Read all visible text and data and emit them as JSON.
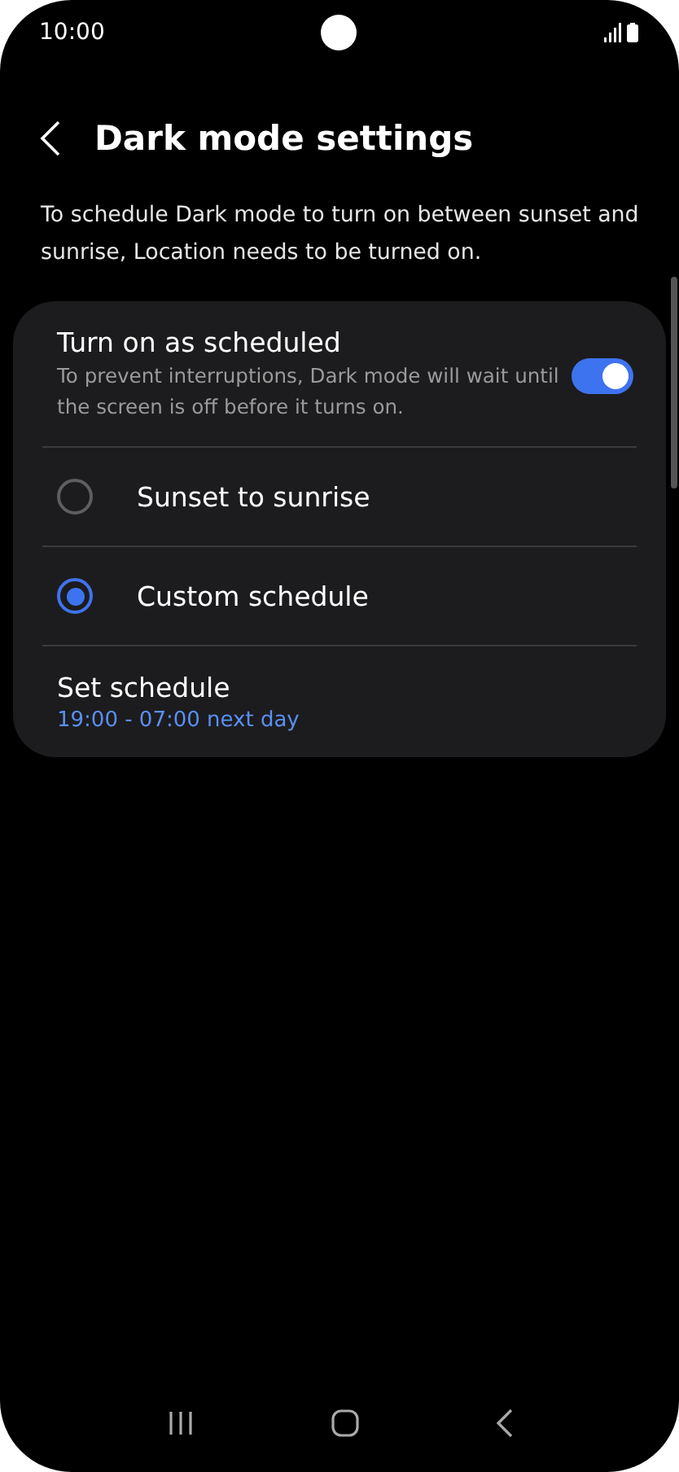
{
  "status_bar": {
    "time": "10:00"
  },
  "header": {
    "title": "Dark mode settings"
  },
  "description": "To schedule Dark mode to turn on between sunset and sunrise, Location needs to be turned on.",
  "schedule_toggle": {
    "label": "Turn on as scheduled",
    "summary": "To prevent interruptions, Dark mode will wait until the screen is off before it turns on.",
    "on": true
  },
  "options": [
    {
      "label": "Sunset to sunrise",
      "selected": false
    },
    {
      "label": "Custom schedule",
      "selected": true
    }
  ],
  "set_schedule": {
    "label": "Set schedule",
    "value": "19:00 - 07:00 next day"
  }
}
